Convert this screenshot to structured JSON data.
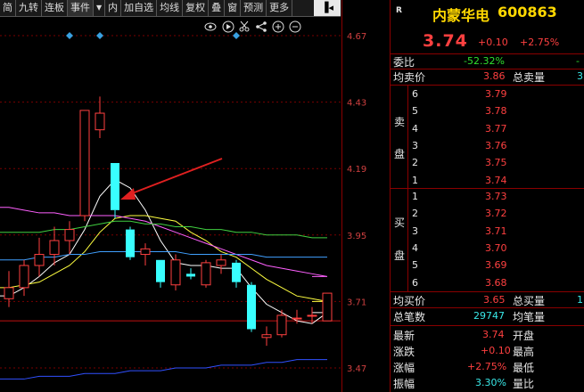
{
  "toolbar": {
    "items": [
      "简",
      "九转",
      "连板",
      "事件",
      "内",
      "加自选",
      "均线",
      "复权",
      "叠",
      "窗",
      "预测",
      "更多"
    ],
    "pin_label": "▐◂"
  },
  "icons": [
    "eye-icon",
    "play-icon",
    "scissors-icon",
    "share-icon",
    "plus-icon",
    "minus-icon"
  ],
  "price_axis": [
    "4.67",
    "4.43",
    "4.19",
    "3.95",
    "3.71",
    "3.47"
  ],
  "quote": {
    "r_label": "R",
    "stock_name": "内蒙华电",
    "stock_code": "600863",
    "price": "3.74",
    "change": "+0.10",
    "change_pct": "+2.75%",
    "wei_bi_label": "委比",
    "wei_bi_value": "-52.32%",
    "wei_bi_extra": "-",
    "avg_sell_label": "均卖价",
    "avg_sell_value": "3.86",
    "total_sell_label": "总卖量",
    "total_sell_value": "3",
    "sell_side_label": [
      "卖",
      "盘"
    ],
    "buy_side_label": [
      "买",
      "盘"
    ],
    "asks": [
      {
        "level": "6",
        "price": "3.79"
      },
      {
        "level": "5",
        "price": "3.78"
      },
      {
        "level": "4",
        "price": "3.77"
      },
      {
        "level": "3",
        "price": "3.76"
      },
      {
        "level": "2",
        "price": "3.75"
      },
      {
        "level": "1",
        "price": "3.74"
      }
    ],
    "bids": [
      {
        "level": "1",
        "price": "3.73"
      },
      {
        "level": "2",
        "price": "3.72"
      },
      {
        "level": "3",
        "price": "3.71"
      },
      {
        "level": "4",
        "price": "3.70"
      },
      {
        "level": "5",
        "price": "3.69"
      },
      {
        "level": "6",
        "price": "3.68"
      }
    ],
    "avg_buy_label": "均买价",
    "avg_buy_value": "3.65",
    "total_buy_label": "总买量",
    "total_buy_value": "1",
    "total_trades_label": "总笔数",
    "total_trades_value": "29747",
    "avg_lot_label": "均笔量",
    "latest_label": "最新",
    "latest_value": "3.74",
    "open_label": "开盘",
    "rise_label": "涨跌",
    "rise_value": "+0.10",
    "high_label": "最高",
    "rise_pct_label": "涨幅",
    "rise_pct_value": "+2.75%",
    "low_label": "最低",
    "amplitude_label": "振幅",
    "amplitude_value": "3.30%",
    "volume_ratio_label": "量比"
  },
  "colors": {
    "up": "#ff4040",
    "down": "#39ffff",
    "ma5": "#ffffff",
    "ma10": "#ffff40",
    "ma20": "#ff60ff",
    "ma30": "#40d040",
    "ma60": "#40a0ff",
    "ma120": "#3050ff",
    "arrow": "#e02020"
  },
  "chart_data": {
    "type": "candlestick",
    "ylim": [
      3.47,
      4.67
    ],
    "y_ticks": [
      4.67,
      4.43,
      4.19,
      3.95,
      3.71,
      3.47
    ],
    "candles": [
      {
        "o": 3.72,
        "h": 3.82,
        "l": 3.69,
        "c": 3.76
      },
      {
        "o": 3.76,
        "h": 3.86,
        "l": 3.73,
        "c": 3.84
      },
      {
        "o": 3.84,
        "h": 3.94,
        "l": 3.8,
        "c": 3.88
      },
      {
        "o": 3.88,
        "h": 3.98,
        "l": 3.84,
        "c": 3.93
      },
      {
        "o": 3.93,
        "h": 4.0,
        "l": 3.88,
        "c": 3.97
      },
      {
        "o": 4.02,
        "h": 4.4,
        "l": 4.0,
        "c": 4.4
      },
      {
        "o": 4.33,
        "h": 4.45,
        "l": 4.3,
        "c": 4.39
      },
      {
        "o": 4.21,
        "h": 4.21,
        "l": 4.01,
        "c": 4.04
      },
      {
        "o": 3.97,
        "h": 3.98,
        "l": 3.86,
        "c": 3.87
      },
      {
        "o": 3.88,
        "h": 3.92,
        "l": 3.84,
        "c": 3.9
      },
      {
        "o": 3.86,
        "h": 3.86,
        "l": 3.76,
        "c": 3.78
      },
      {
        "o": 3.77,
        "h": 3.88,
        "l": 3.75,
        "c": 3.86
      },
      {
        "o": 3.81,
        "h": 3.83,
        "l": 3.79,
        "c": 3.8
      },
      {
        "o": 3.77,
        "h": 3.86,
        "l": 3.76,
        "c": 3.85
      },
      {
        "o": 3.84,
        "h": 3.88,
        "l": 3.81,
        "c": 3.86
      },
      {
        "o": 3.85,
        "h": 3.86,
        "l": 3.76,
        "c": 3.78
      },
      {
        "o": 3.77,
        "h": 3.78,
        "l": 3.6,
        "c": 3.61
      },
      {
        "o": 3.58,
        "h": 3.62,
        "l": 3.55,
        "c": 3.59
      },
      {
        "o": 3.59,
        "h": 3.68,
        "l": 3.58,
        "c": 3.66
      },
      {
        "o": 3.65,
        "h": 3.68,
        "l": 3.63,
        "c": 3.65
      },
      {
        "o": 3.66,
        "h": 3.69,
        "l": 3.63,
        "c": 3.66
      },
      {
        "o": 3.64,
        "h": 3.73,
        "l": 3.64,
        "c": 3.74
      }
    ],
    "moving_averages": [
      {
        "name": "MA5",
        "color": "#ffffff",
        "values": [
          3.73,
          3.76,
          3.8,
          3.85,
          3.88,
          3.97,
          4.09,
          4.15,
          4.12,
          4.04,
          3.93,
          3.85,
          3.84,
          3.84,
          3.83,
          3.83,
          3.76,
          3.7,
          3.67,
          3.64,
          3.63,
          3.67
        ]
      },
      {
        "name": "MA10",
        "color": "#ffff40",
        "values": [
          3.76,
          3.77,
          3.78,
          3.81,
          3.84,
          3.89,
          3.96,
          4.01,
          4.02,
          4.02,
          4.01,
          4.0,
          3.96,
          3.93,
          3.89,
          3.87,
          3.83,
          3.79,
          3.76,
          3.73,
          3.72,
          3.71
        ]
      },
      {
        "name": "MA20",
        "color": "#ff60ff",
        "values": [
          4.05,
          4.04,
          4.03,
          4.03,
          4.02,
          4.02,
          4.02,
          4.02,
          4.01,
          4.0,
          3.98,
          3.96,
          3.94,
          3.92,
          3.9,
          3.88,
          3.86,
          3.84,
          3.83,
          3.82,
          3.81,
          3.8
        ]
      },
      {
        "name": "MA30",
        "color": "#40d040",
        "values": [
          3.96,
          3.96,
          3.96,
          3.97,
          3.97,
          3.98,
          3.99,
          4.0,
          4.0,
          3.99,
          3.99,
          3.98,
          3.98,
          3.97,
          3.97,
          3.96,
          3.96,
          3.95,
          3.95,
          3.95,
          3.94,
          3.94
        ]
      },
      {
        "name": "MA60",
        "color": "#40a0ff",
        "values": [
          3.86,
          3.86,
          3.87,
          3.87,
          3.88,
          3.88,
          3.89,
          3.89,
          3.89,
          3.89,
          3.89,
          3.89,
          3.88,
          3.88,
          3.88,
          3.88,
          3.88,
          3.87,
          3.87,
          3.87,
          3.87,
          3.87
        ]
      },
      {
        "name": "MA120",
        "color": "#3050ff",
        "values": [
          3.43,
          3.43,
          3.44,
          3.44,
          3.44,
          3.45,
          3.45,
          3.45,
          3.46,
          3.46,
          3.46,
          3.47,
          3.47,
          3.47,
          3.48,
          3.48,
          3.48,
          3.49,
          3.49,
          3.5,
          3.5,
          3.5
        ]
      }
    ],
    "horizontal_line": 3.64,
    "markers": [
      "diamond",
      "diamond",
      "diamond"
    ],
    "annotation": "arrow"
  }
}
